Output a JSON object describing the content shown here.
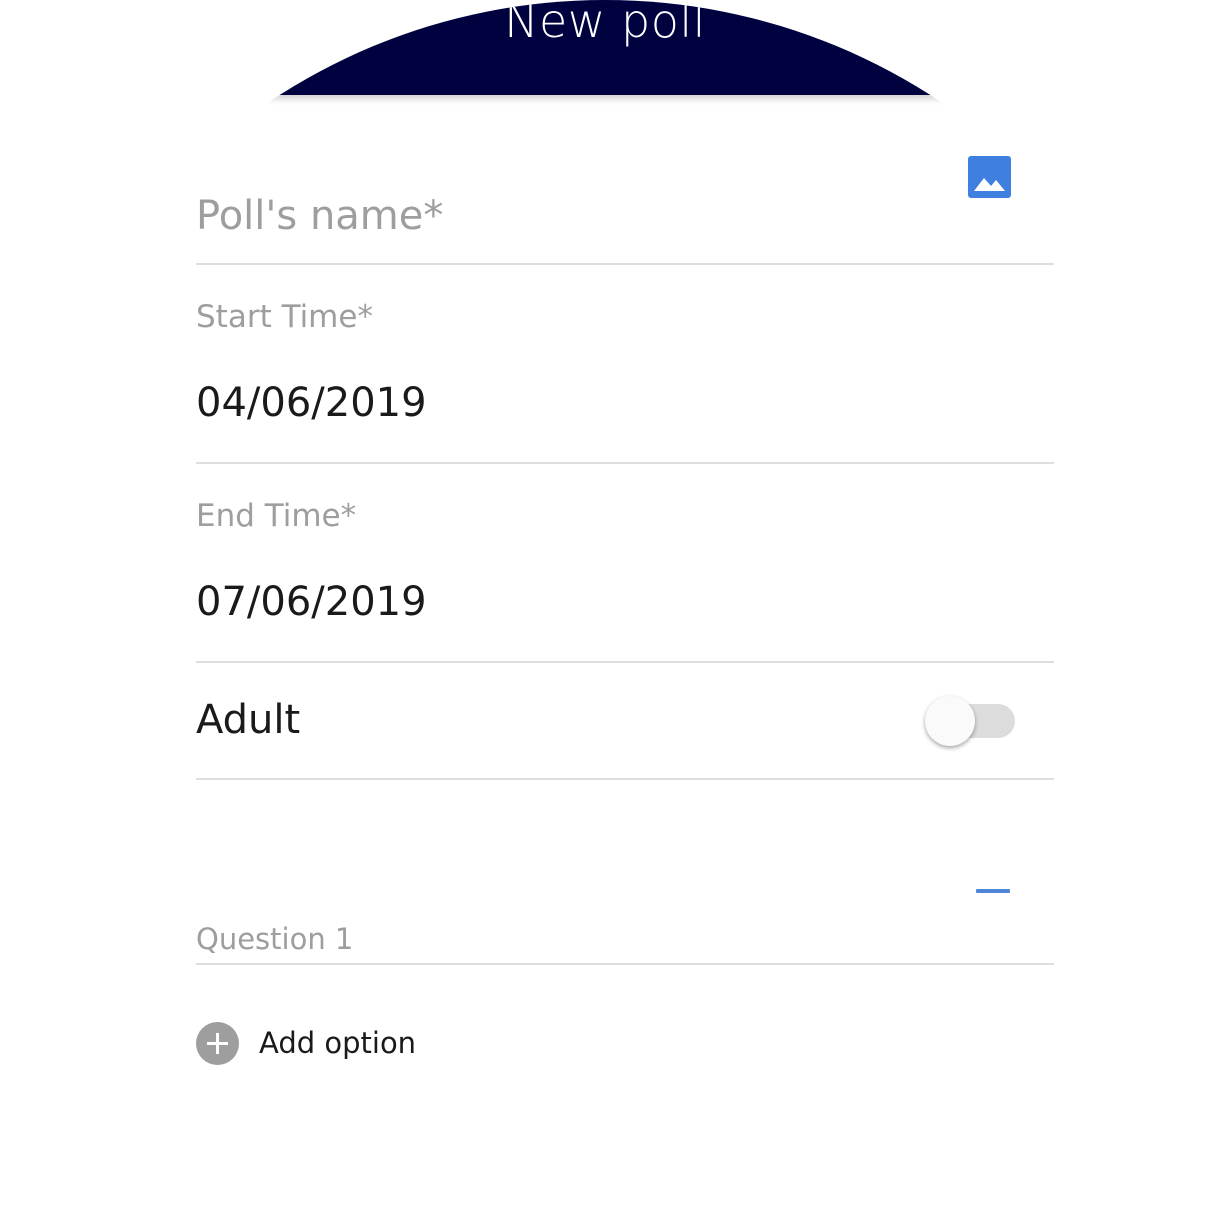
{
  "header": {
    "title": "New poll",
    "background_color": "#00023f"
  },
  "form": {
    "poll_name": {
      "placeholder": "Poll's name*",
      "value": ""
    },
    "image_button": {
      "icon": "image-icon",
      "color": "#3f7fe0"
    },
    "start_time": {
      "label": "Start Time*",
      "value": "04/06/2019"
    },
    "end_time": {
      "label": "End Time*",
      "value": "07/06/2019"
    },
    "adult": {
      "label": "Adult",
      "enabled": false
    },
    "questions": [
      {
        "placeholder": "Question 1",
        "remove_icon": "minus-icon"
      }
    ],
    "add_option": {
      "label": "Add option",
      "icon": "plus-circle-icon"
    }
  },
  "colors": {
    "accent": "#4f86d8",
    "hint_text": "#9e9e9e",
    "divider": "#dedede"
  }
}
